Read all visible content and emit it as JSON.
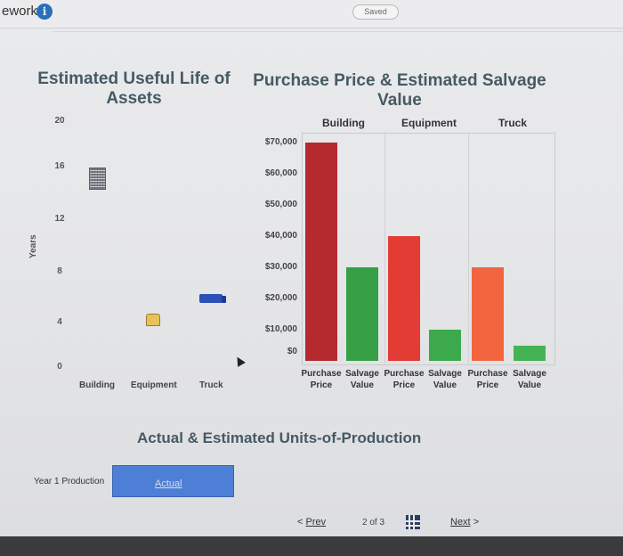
{
  "header": {
    "app_title": "ework",
    "info_icon": "i",
    "status": "Saved"
  },
  "left_chart": {
    "title": "Estimated Useful Life of Assets",
    "y_axis_label": "Years",
    "y_ticks": [
      "20",
      "16",
      "12",
      "8",
      "4",
      "0"
    ],
    "categories": [
      "Building",
      "Equipment",
      "Truck"
    ]
  },
  "chart_data": {
    "type": "bar",
    "title": "Purchase Price & Estimated Salvage Value",
    "groups": [
      "Building",
      "Equipment",
      "Truck"
    ],
    "bar_labels": [
      [
        "Purchase",
        "Price"
      ],
      [
        "Salvage",
        "Value"
      ],
      [
        "Purchase",
        "Price"
      ],
      [
        "Salvage",
        "Value"
      ],
      [
        "Purchase",
        "Price"
      ],
      [
        "Salvage",
        "Value"
      ]
    ],
    "y_ticks": [
      "$70,000",
      "$60,000",
      "$50,000",
      "$40,000",
      "$30,000",
      "$20,000",
      "$10,000",
      "$0"
    ],
    "ylim": [
      0,
      70000
    ],
    "bars": [
      {
        "group": "Building",
        "kind": "Purchase Price",
        "value": 70000,
        "color": "#b42a2f"
      },
      {
        "group": "Building",
        "kind": "Salvage Value",
        "value": 30000,
        "color": "#37a047"
      },
      {
        "group": "Equipment",
        "kind": "Purchase Price",
        "value": 40000,
        "color": "#e23c35"
      },
      {
        "group": "Equipment",
        "kind": "Salvage Value",
        "value": 10000,
        "color": "#3caa4c"
      },
      {
        "group": "Truck",
        "kind": "Purchase Price",
        "value": 30000,
        "color": "#f2653f"
      },
      {
        "group": "Truck",
        "kind": "Salvage Value",
        "value": 5000,
        "color": "#45b255"
      }
    ]
  },
  "units_production": {
    "title": "Actual & Estimated Units-of-Production",
    "row_label": "Year 1 Production",
    "actual_label": "Actual"
  },
  "nav": {
    "prev_label": "Prev",
    "prev_glyph": "<",
    "page_indicator": "2 of 3",
    "next_label": "Next",
    "next_glyph": ">"
  }
}
